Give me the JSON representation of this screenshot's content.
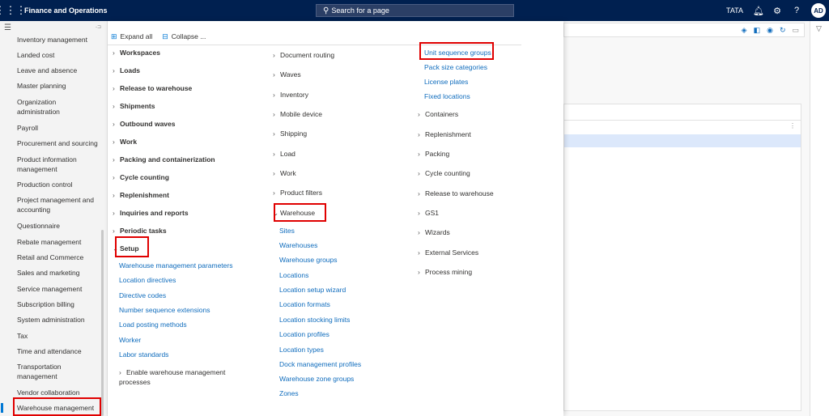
{
  "app": {
    "title": "Finance and Operations",
    "search_placeholder": "Search for a page",
    "company": "TATA",
    "user_initials": "AD",
    "accent": "#002050"
  },
  "nav": {
    "items": [
      "Inventory management",
      "Landed cost",
      "Leave and absence",
      "Master planning",
      "Organization administration",
      "Payroll",
      "Procurement and sourcing",
      "Product information management",
      "Production control",
      "Project management and accounting",
      "Questionnaire",
      "Rebate management",
      "Retail and Commerce",
      "Sales and marketing",
      "Service management",
      "Subscription billing",
      "System administration",
      "Tax",
      "Time and attendance",
      "Transportation management",
      "Vendor collaboration",
      "Warehouse management"
    ],
    "selected": "Warehouse management"
  },
  "menu": {
    "expand_all": "Expand all",
    "collapse": "Collapse ...",
    "col1_groups": [
      "Workspaces",
      "Loads",
      "Release to warehouse",
      "Shipments",
      "Outbound waves",
      "Work",
      "Packing and containerization",
      "Cycle counting",
      "Replenishment",
      "Inquiries and reports",
      "Periodic tasks",
      "Setup"
    ],
    "setup_links": [
      "Warehouse management parameters",
      "Location directives",
      "Directive codes",
      "Number sequence extensions",
      "Load posting methods",
      "Worker",
      "Labor standards"
    ],
    "enable_group": "Enable warehouse management processes",
    "col2_groups": [
      "Document routing",
      "Waves",
      "Inventory",
      "Mobile device",
      "Shipping",
      "Load",
      "Work",
      "Product filters",
      "Warehouse"
    ],
    "warehouse_links": [
      "Sites",
      "Warehouses",
      "Warehouse groups",
      "Locations",
      "Location setup wizard",
      "Location formats",
      "Location stocking limits",
      "Location profiles",
      "Location types",
      "Dock management profiles",
      "Warehouse zone groups",
      "Zones"
    ],
    "col3_links": [
      "Unit sequence groups",
      "Pack size categories",
      "License plates",
      "Fixed locations"
    ],
    "col3_groups": [
      "Containers",
      "Replenishment",
      "Packing",
      "Cycle counting",
      "Release to warehouse",
      "GS1",
      "Wizards",
      "External Services",
      "Process mining"
    ]
  }
}
